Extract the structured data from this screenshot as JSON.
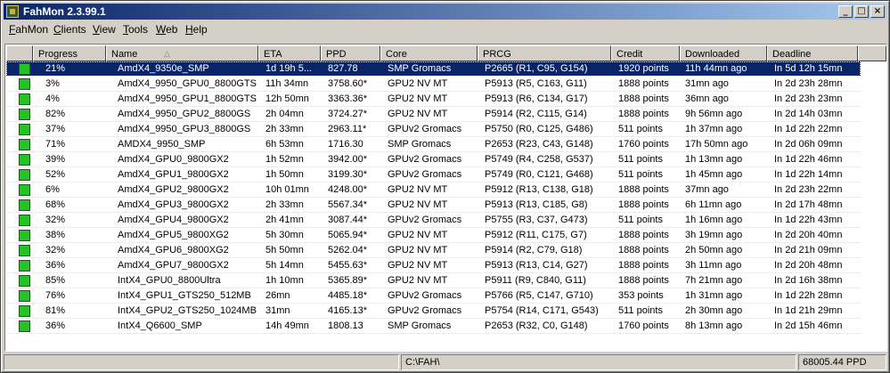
{
  "window": {
    "title": "FahMon 2.3.99.1"
  },
  "menu": [
    "FahMon",
    "Clients",
    "View",
    "Tools",
    "Web",
    "Help"
  ],
  "columns": [
    "Progress",
    "Name",
    "ETA",
    "PPD",
    "Core",
    "PRCG",
    "Credit",
    "Downloaded",
    "Deadline"
  ],
  "status_color": "#22c322",
  "rows": [
    {
      "progress": "21%",
      "name": "AmdX4_9350e_SMP",
      "eta": "1d 19h 5...",
      "ppd": "827.78",
      "core": "SMP Gromacs",
      "prcg": "P2665 (R1, C95, G154)",
      "credit": "1920 points",
      "downloaded": "11h 44mn ago",
      "deadline": "In 5d 12h 15mn"
    },
    {
      "progress": "3%",
      "name": "AmdX4_9950_GPU0_8800GTS",
      "eta": "11h 34mn",
      "ppd": "3758.60*",
      "core": "GPU2 NV MT",
      "prcg": "P5913 (R5, C163, G11)",
      "credit": "1888 points",
      "downloaded": "31mn ago",
      "deadline": "In 2d 23h 28mn"
    },
    {
      "progress": "4%",
      "name": "AmdX4_9950_GPU1_8800GTS",
      "eta": "12h 50mn",
      "ppd": "3363.36*",
      "core": "GPU2 NV MT",
      "prcg": "P5913 (R6, C134, G17)",
      "credit": "1888 points",
      "downloaded": "36mn ago",
      "deadline": "In 2d 23h 23mn"
    },
    {
      "progress": "82%",
      "name": "AmdX4_9950_GPU2_8800GS",
      "eta": "2h 04mn",
      "ppd": "3724.27*",
      "core": "GPU2 NV MT",
      "prcg": "P5914 (R2, C115, G14)",
      "credit": "1888 points",
      "downloaded": "9h 56mn ago",
      "deadline": "In 2d 14h 03mn"
    },
    {
      "progress": "37%",
      "name": "AmdX4_9950_GPU3_8800GS",
      "eta": "2h 33mn",
      "ppd": "2963.11*",
      "core": "GPUv2 Gromacs",
      "prcg": "P5750 (R0, C125, G486)",
      "credit": "511 points",
      "downloaded": "1h 37mn ago",
      "deadline": "In 1d 22h 22mn"
    },
    {
      "progress": "71%",
      "name": "AMDX4_9950_SMP",
      "eta": "6h 53mn",
      "ppd": "1716.30",
      "core": "SMP Gromacs",
      "prcg": "P2653 (R23, C43, G148)",
      "credit": "1760 points",
      "downloaded": "17h 50mn ago",
      "deadline": "In 2d 06h 09mn"
    },
    {
      "progress": "39%",
      "name": "AmdX4_GPU0_9800GX2",
      "eta": "1h 52mn",
      "ppd": "3942.00*",
      "core": "GPUv2 Gromacs",
      "prcg": "P5749 (R4, C258, G537)",
      "credit": "511 points",
      "downloaded": "1h 13mn ago",
      "deadline": "In 1d 22h 46mn"
    },
    {
      "progress": "52%",
      "name": "AmdX4_GPU1_9800GX2",
      "eta": "1h 50mn",
      "ppd": "3199.30*",
      "core": "GPUv2 Gromacs",
      "prcg": "P5749 (R0, C121, G468)",
      "credit": "511 points",
      "downloaded": "1h 45mn ago",
      "deadline": "In 1d 22h 14mn"
    },
    {
      "progress": "6%",
      "name": "AmdX4_GPU2_9800GX2",
      "eta": "10h 01mn",
      "ppd": "4248.00*",
      "core": "GPU2 NV MT",
      "prcg": "P5912 (R13, C138, G18)",
      "credit": "1888 points",
      "downloaded": "37mn ago",
      "deadline": "In 2d 23h 22mn"
    },
    {
      "progress": "68%",
      "name": "AmdX4_GPU3_9800GX2",
      "eta": "2h 33mn",
      "ppd": "5567.34*",
      "core": "GPU2 NV MT",
      "prcg": "P5913 (R13, C185, G8)",
      "credit": "1888 points",
      "downloaded": "6h 11mn ago",
      "deadline": "In 2d 17h 48mn"
    },
    {
      "progress": "32%",
      "name": "AmdX4_GPU4_9800GX2",
      "eta": "2h 41mn",
      "ppd": "3087.44*",
      "core": "GPUv2 Gromacs",
      "prcg": "P5755 (R3, C37, G473)",
      "credit": "511 points",
      "downloaded": "1h 16mn ago",
      "deadline": "In 1d 22h 43mn"
    },
    {
      "progress": "38%",
      "name": "AmdX4_GPU5_9800XG2",
      "eta": "5h 30mn",
      "ppd": "5065.94*",
      "core": "GPU2 NV MT",
      "prcg": "P5912 (R11, C175, G7)",
      "credit": "1888 points",
      "downloaded": "3h 19mn ago",
      "deadline": "In 2d 20h 40mn"
    },
    {
      "progress": "32%",
      "name": "AmdX4_GPU6_9800XG2",
      "eta": "5h 50mn",
      "ppd": "5262.04*",
      "core": "GPU2 NV MT",
      "prcg": "P5914 (R2, C79, G18)",
      "credit": "1888 points",
      "downloaded": "2h 50mn ago",
      "deadline": "In 2d 21h 09mn"
    },
    {
      "progress": "36%",
      "name": "AmdX4_GPU7_9800GX2",
      "eta": "5h 14mn",
      "ppd": "5455.63*",
      "core": "GPU2 NV MT",
      "prcg": "P5913 (R13, C14, G27)",
      "credit": "1888 points",
      "downloaded": "3h 11mn ago",
      "deadline": "In 2d 20h 48mn"
    },
    {
      "progress": "85%",
      "name": "IntX4_GPU0_8800Ultra",
      "eta": "1h 10mn",
      "ppd": "5365.89*",
      "core": "GPU2 NV MT",
      "prcg": "P5911 (R9, C840, G11)",
      "credit": "1888 points",
      "downloaded": "7h 21mn ago",
      "deadline": "In 2d 16h 38mn"
    },
    {
      "progress": "76%",
      "name": "IntX4_GPU1_GTS250_512MB",
      "eta": "26mn",
      "ppd": "4485.18*",
      "core": "GPUv2 Gromacs",
      "prcg": "P5766 (R5, C147, G710)",
      "credit": "353 points",
      "downloaded": "1h 31mn ago",
      "deadline": "In 1d 22h 28mn"
    },
    {
      "progress": "81%",
      "name": "IntX4_GPU2_GTS250_1024MB",
      "eta": "31mn",
      "ppd": "4165.13*",
      "core": "GPUv2 Gromacs",
      "prcg": "P5754 (R14, C171, G543)",
      "credit": "511 points",
      "downloaded": "2h 30mn ago",
      "deadline": "In 1d 21h 29mn"
    },
    {
      "progress": "36%",
      "name": "IntX4_Q6600_SMP",
      "eta": "14h 49mn",
      "ppd": "1808.13",
      "core": "SMP Gromacs",
      "prcg": "P2653 (R32, C0, G148)",
      "credit": "1760 points",
      "downloaded": "8h 13mn ago",
      "deadline": "In 2d 15h 46mn"
    }
  ],
  "status": {
    "left": "",
    "path": "C:\\FAH\\",
    "total_ppd": "68005.44 PPD"
  }
}
